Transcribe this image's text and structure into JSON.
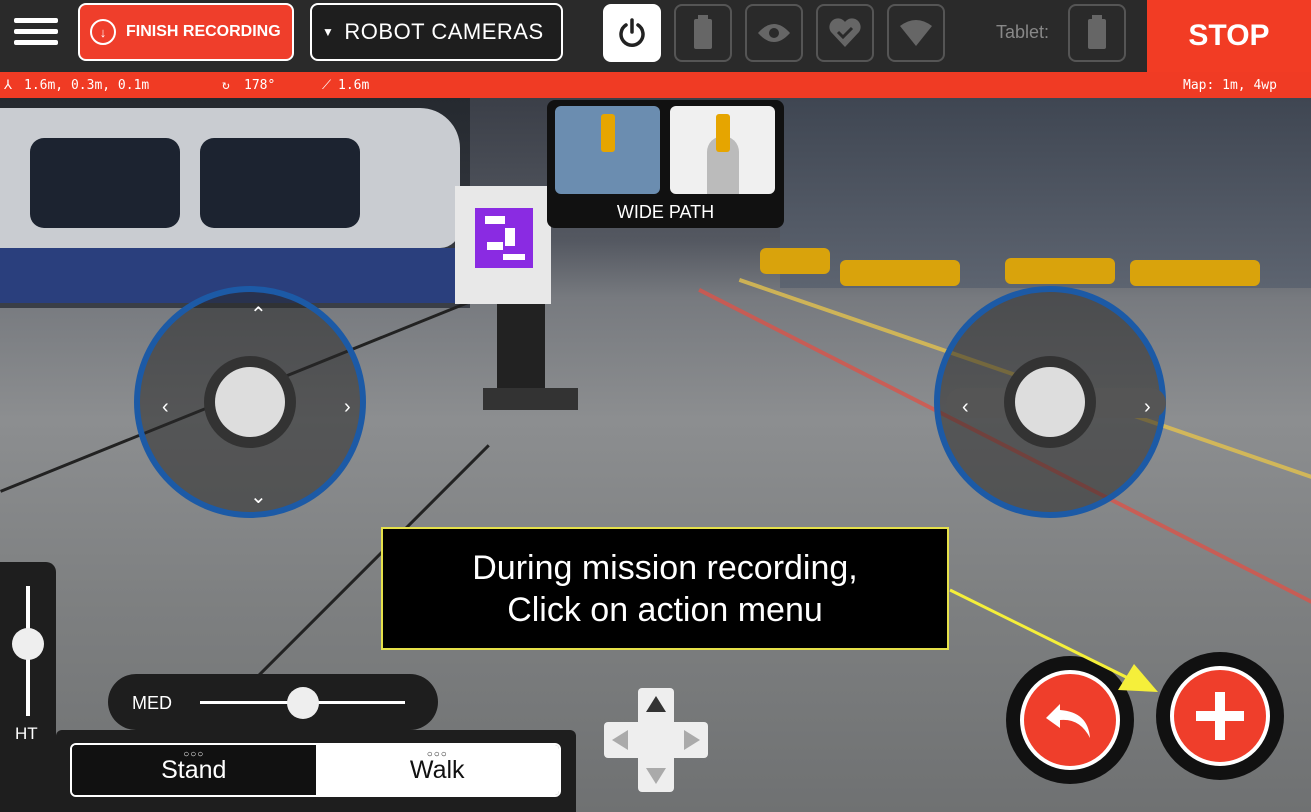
{
  "topbar": {
    "finish_label": "FINISH RECORDING",
    "camera_select": "ROBOT CAMERAS",
    "tablet_label": "Tablet:",
    "stop_label": "STOP",
    "icons": [
      "power-icon",
      "battery-icon",
      "eye-icon",
      "heart-icon",
      "wifi-icon"
    ]
  },
  "status": {
    "position": "1.6m, 0.3m, 0.1m",
    "rotation": "178°",
    "distance": "1.6m",
    "map": "Map: 1m, 4wp"
  },
  "path_panel": {
    "label": "WIDE PATH"
  },
  "tooltip": {
    "line1": "During mission recording,",
    "line2": "Click on action menu",
    "border_color": "#e6e14a"
  },
  "height": {
    "label": "HT"
  },
  "speed": {
    "label": "MED",
    "level": 0.5
  },
  "mode": {
    "stand": "Stand",
    "walk": "Walk",
    "dots": "○○○",
    "selected": "Stand"
  },
  "colors": {
    "accent": "#ef3e2b",
    "joystick_ring": "#1c5aa6"
  }
}
